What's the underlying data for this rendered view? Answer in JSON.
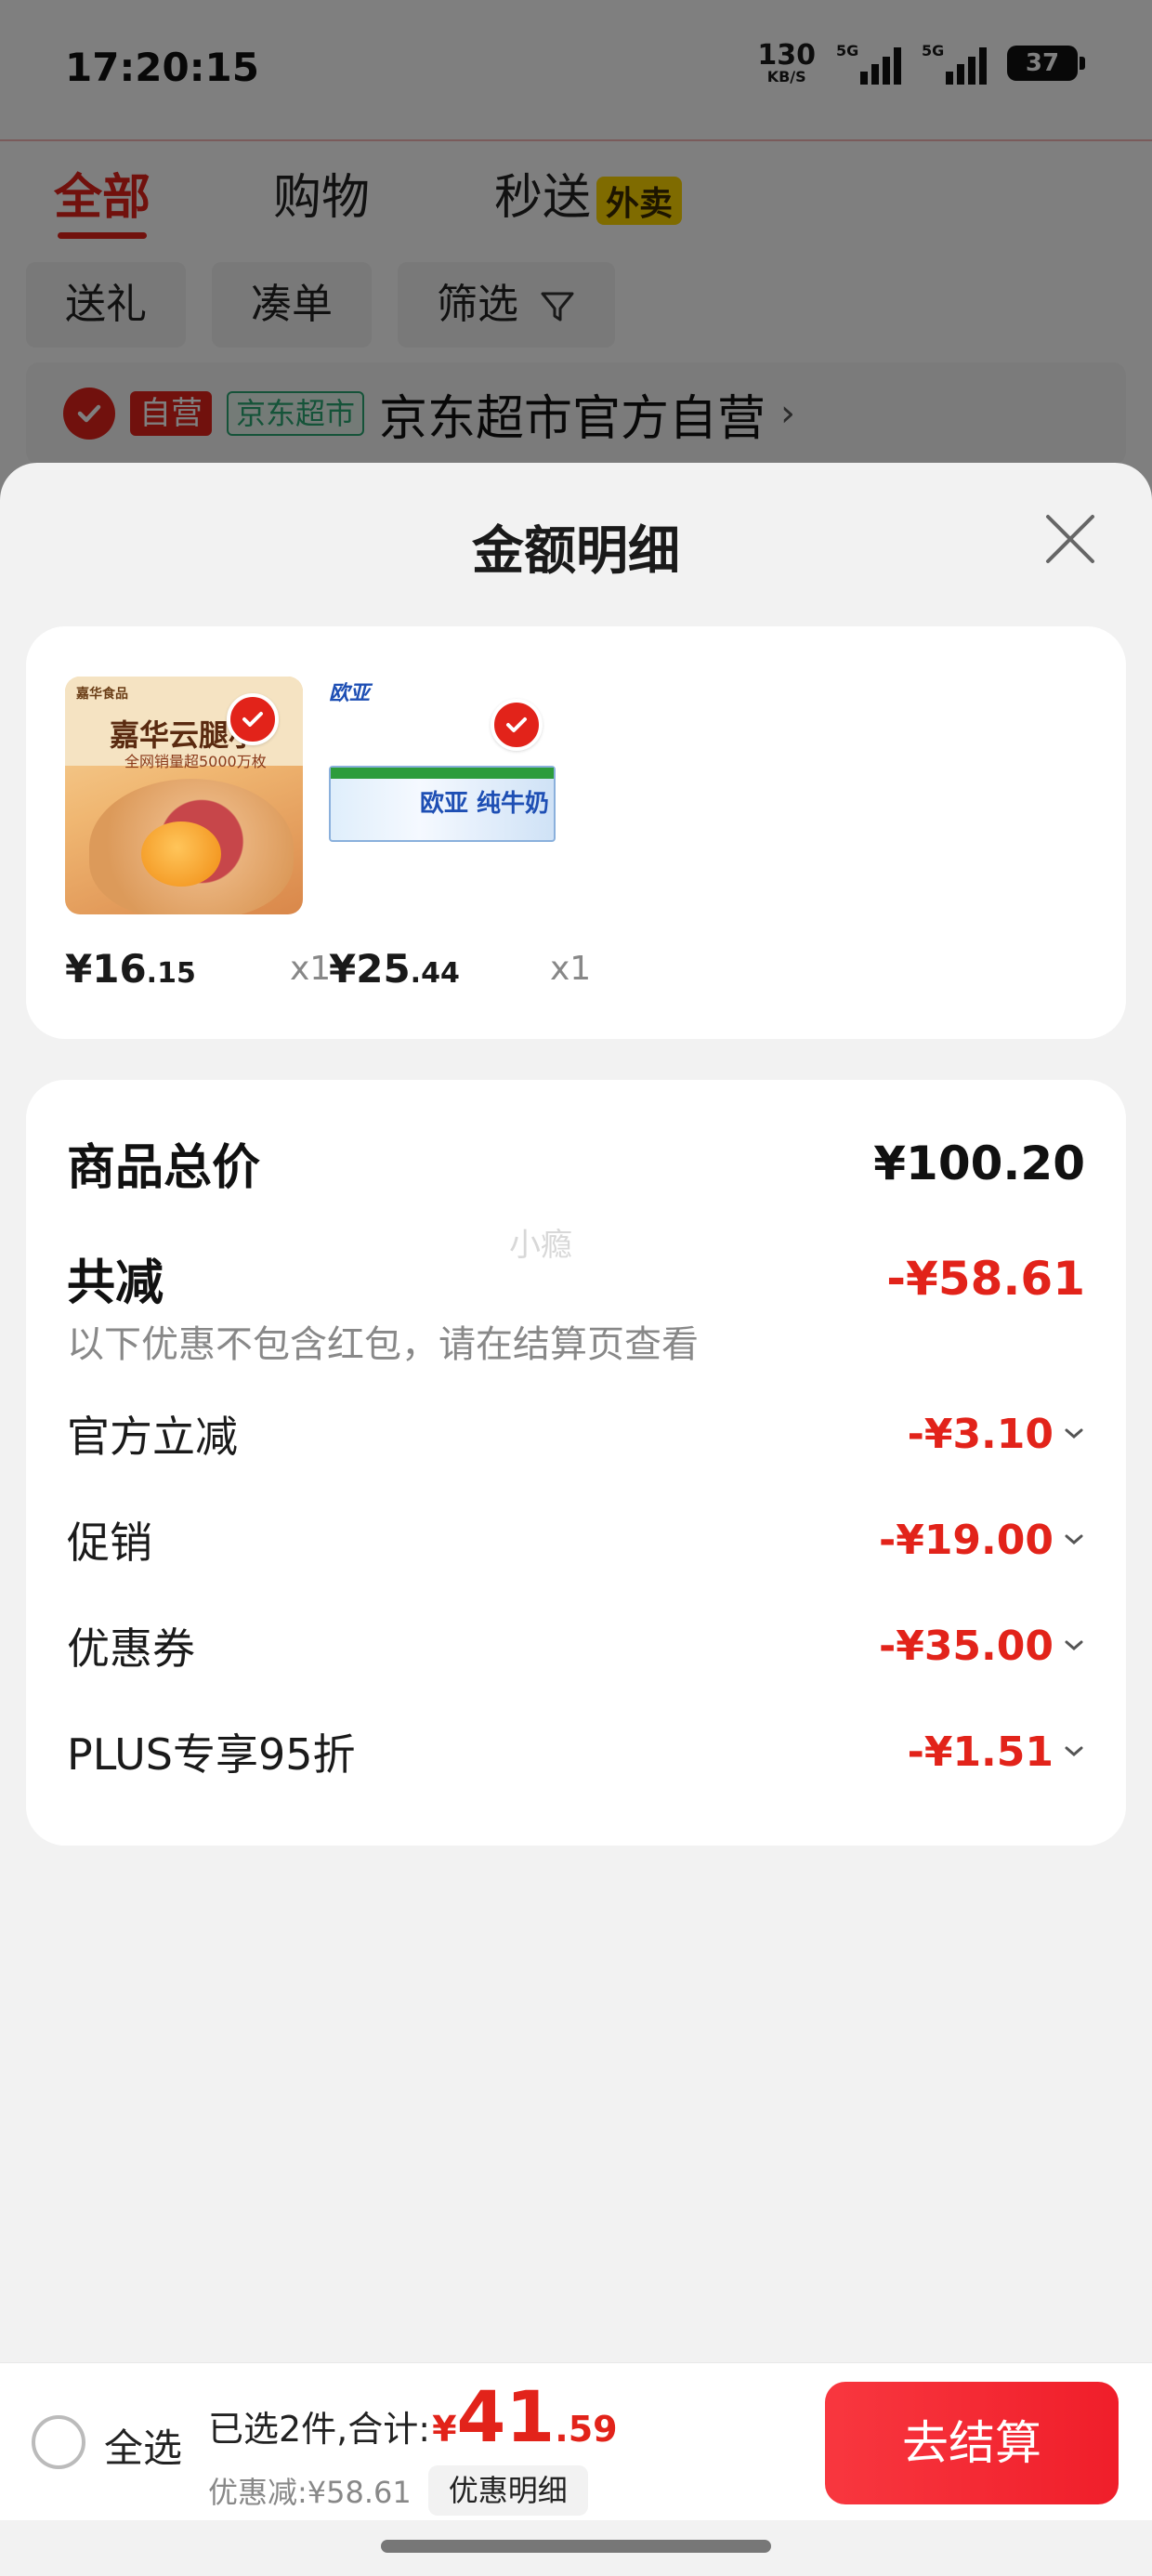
{
  "status_bar": {
    "time": "17:20:15",
    "net_speed": "130",
    "net_unit": "KB/S",
    "sig1_label": "5G",
    "sig2_label": "5G",
    "battery": "37"
  },
  "bg_tabs": {
    "all": "全部",
    "shopping": "购物",
    "express": "秒送",
    "express_badge": "外卖"
  },
  "chips": [
    "送礼",
    "凑单",
    "筛选"
  ],
  "store": {
    "tag_self": "自营",
    "tag_jd": "京东超市",
    "name": "京东超市官方自营",
    "arrow": "›"
  },
  "sheet": {
    "title": "金额明细",
    "close_icon": "close-icon"
  },
  "items": [
    {
      "price_int": "¥16",
      "price_dec": ".15",
      "qty": "x1",
      "img_brand": "嘉华食品",
      "img_title": "嘉华云腿小",
      "img_sub": "全网销量超5000万枚"
    },
    {
      "price_int": "¥25",
      "price_dec": ".44",
      "qty": "x1",
      "img_logo": "欧亚",
      "img_brand": "欧亚 纯牛奶"
    }
  ],
  "summary": {
    "total_label": "商品总价",
    "total_value": "¥100.20",
    "reduce_label": "共减",
    "reduce_value": "-¥58.61",
    "hint": "以下优惠不包含红包，请在结算页查看",
    "watermark": "小瘾",
    "lines": [
      {
        "label": "官方立减",
        "value": "-¥3.10"
      },
      {
        "label": "促销",
        "value": "-¥19.00"
      },
      {
        "label": "优惠券",
        "value": "-¥35.00"
      },
      {
        "label": "PLUS专享95折",
        "value": "-¥1.51"
      }
    ]
  },
  "bottom": {
    "select_all": "全选",
    "selected_text": "已选2件,合计:",
    "total_yen": "¥",
    "total_int": "41",
    "total_dec": ".59",
    "discount_text": "优惠减:¥58.61",
    "discount_button": "优惠明细",
    "checkout": "去结算"
  },
  "colors": {
    "accent": "#e2231a",
    "checkout_start": "#f8373f",
    "checkout_end": "#f01e2a"
  }
}
